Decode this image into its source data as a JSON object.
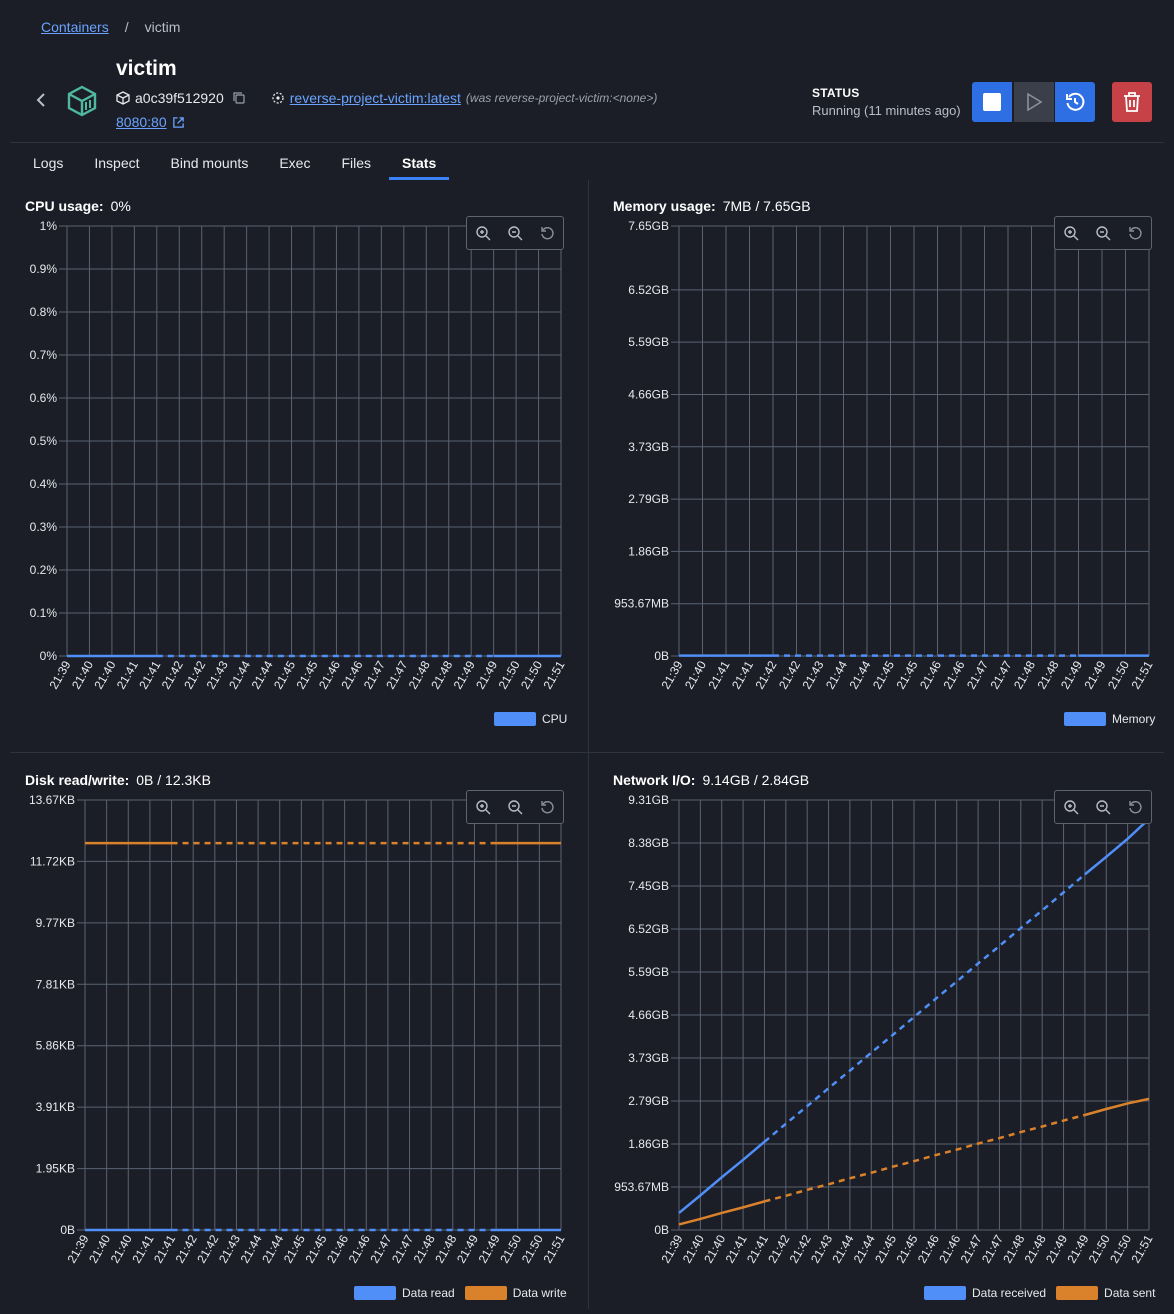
{
  "breadcrumb": {
    "root": "Containers",
    "sep": "/",
    "current": "victim"
  },
  "container": {
    "name": "victim",
    "id": "a0c39f512920",
    "image": "reverse-project-victim:latest",
    "image_was": "(was reverse-project-victim:<none>)",
    "port": "8080:80"
  },
  "status": {
    "label": "STATUS",
    "text": "Running (11 minutes ago)"
  },
  "tabs": [
    {
      "label": "Logs"
    },
    {
      "label": "Inspect"
    },
    {
      "label": "Bind mounts"
    },
    {
      "label": "Exec"
    },
    {
      "label": "Files"
    },
    {
      "label": "Stats",
      "active": true
    }
  ],
  "colors": {
    "blue": "#4f8ff7",
    "orange": "#d9822b",
    "grid": "#5a6272"
  },
  "icons": [
    "chevron-left-icon",
    "cube-icon",
    "box-icon",
    "copy-icon",
    "image-icon",
    "external-link-icon",
    "stop-icon",
    "play-icon",
    "restart-icon",
    "trash-icon",
    "zoom-in-icon",
    "zoom-out-icon",
    "reset-zoom-icon"
  ],
  "panels": {
    "cpu": {
      "title": "CPU usage:",
      "value": "0%"
    },
    "memory": {
      "title": "Memory usage:",
      "value": "7MB / 7.65GB"
    },
    "disk": {
      "title": "Disk read/write:",
      "value": "0B / 12.3KB"
    },
    "network": {
      "title": "Network I/O:",
      "value": "9.14GB / 2.84GB"
    }
  },
  "chart_data": [
    {
      "id": "cpu",
      "type": "line",
      "x": [
        "21:39",
        "21:40",
        "21:40",
        "21:41",
        "21:41",
        "21:42",
        "21:42",
        "21:43",
        "21:44",
        "21:44",
        "21:45",
        "21:45",
        "21:46",
        "21:46",
        "21:47",
        "21:47",
        "21:48",
        "21:48",
        "21:49",
        "21:49",
        "21:50",
        "21:50",
        "21:51"
      ],
      "yticks": [
        "0%",
        "0.1%",
        "0.2%",
        "0.3%",
        "0.4%",
        "0.5%",
        "0.6%",
        "0.7%",
        "0.8%",
        "0.9%",
        "1%"
      ],
      "ylim": [
        0,
        1
      ],
      "series": [
        {
          "name": "CPU",
          "color": "#4f8ff7",
          "values": [
            0,
            0,
            0,
            0,
            0,
            0,
            0,
            0,
            0,
            0,
            0,
            0,
            0,
            0,
            0,
            0,
            0,
            0,
            0,
            0,
            0,
            0,
            0
          ]
        }
      ]
    },
    {
      "id": "memory",
      "type": "line",
      "x": [
        "21:39",
        "21:40",
        "21:41",
        "21:41",
        "21:42",
        "21:42",
        "21:43",
        "21:44",
        "21:44",
        "21:45",
        "21:45",
        "21:46",
        "21:46",
        "21:47",
        "21:47",
        "21:48",
        "21:48",
        "21:49",
        "21:49",
        "21:50",
        "21:51"
      ],
      "yticks": [
        "0B",
        "953.67MB",
        "1.86GB",
        "2.79GB",
        "3.73GB",
        "4.66GB",
        "5.59GB",
        "6.52GB",
        "7.65GB"
      ],
      "ylim": [
        0,
        7.65
      ],
      "series": [
        {
          "name": "Memory",
          "color": "#4f8ff7",
          "values": [
            0.007,
            0.007,
            0.007,
            0.007,
            0.007,
            0.007,
            0.007,
            0.007,
            0.007,
            0.007,
            0.007,
            0.007,
            0.007,
            0.007,
            0.007,
            0.007,
            0.007,
            0.007,
            0.007,
            0.007,
            0.007
          ]
        }
      ]
    },
    {
      "id": "disk",
      "type": "line",
      "x": [
        "21:39",
        "21:40",
        "21:40",
        "21:41",
        "21:41",
        "21:42",
        "21:42",
        "21:43",
        "21:44",
        "21:44",
        "21:45",
        "21:45",
        "21:46",
        "21:46",
        "21:47",
        "21:47",
        "21:48",
        "21:48",
        "21:49",
        "21:49",
        "21:50",
        "21:50",
        "21:51"
      ],
      "yticks": [
        "0B",
        "1.95KB",
        "3.91KB",
        "5.86KB",
        "7.81KB",
        "9.77KB",
        "11.72KB",
        "13.67KB"
      ],
      "ylim": [
        0,
        13.67
      ],
      "series": [
        {
          "name": "Data read",
          "color": "#4f8ff7",
          "values": [
            0,
            0,
            0,
            0,
            0,
            0,
            0,
            0,
            0,
            0,
            0,
            0,
            0,
            0,
            0,
            0,
            0,
            0,
            0,
            0,
            0,
            0,
            0
          ]
        },
        {
          "name": "Data write",
          "color": "#d9822b",
          "values": [
            12.3,
            12.3,
            12.3,
            12.3,
            12.3,
            12.3,
            12.3,
            12.3,
            12.3,
            12.3,
            12.3,
            12.3,
            12.3,
            12.3,
            12.3,
            12.3,
            12.3,
            12.3,
            12.3,
            12.3,
            12.3,
            12.3,
            12.3
          ]
        }
      ]
    },
    {
      "id": "network",
      "type": "line",
      "x": [
        "21:39",
        "21:40",
        "21:40",
        "21:41",
        "21:41",
        "21:42",
        "21:42",
        "21:43",
        "21:44",
        "21:44",
        "21:45",
        "21:45",
        "21:46",
        "21:46",
        "21:47",
        "21:47",
        "21:48",
        "21:48",
        "21:49",
        "21:49",
        "21:50",
        "21:50",
        "21:51"
      ],
      "yticks": [
        "0B",
        "953.67MB",
        "1.86GB",
        "2.79GB",
        "3.73GB",
        "4.66GB",
        "5.59GB",
        "6.52GB",
        "7.45GB",
        "8.38GB",
        "9.31GB"
      ],
      "ylim": [
        0,
        9.31
      ],
      "series": [
        {
          "name": "Data received",
          "color": "#4f8ff7",
          "values": [
            0.37,
            0.75,
            1.14,
            1.52,
            1.91,
            2.3,
            2.68,
            3.07,
            3.45,
            3.84,
            4.22,
            4.61,
            5.0,
            5.38,
            5.77,
            6.15,
            6.54,
            6.92,
            7.31,
            7.7,
            8.08,
            8.47,
            8.9
          ]
        },
        {
          "name": "Data sent",
          "color": "#d9822b",
          "values": [
            0.12,
            0.24,
            0.37,
            0.49,
            0.62,
            0.74,
            0.87,
            0.99,
            1.12,
            1.24,
            1.37,
            1.49,
            1.62,
            1.74,
            1.87,
            1.99,
            2.12,
            2.24,
            2.37,
            2.49,
            2.62,
            2.74,
            2.84
          ]
        }
      ]
    }
  ]
}
